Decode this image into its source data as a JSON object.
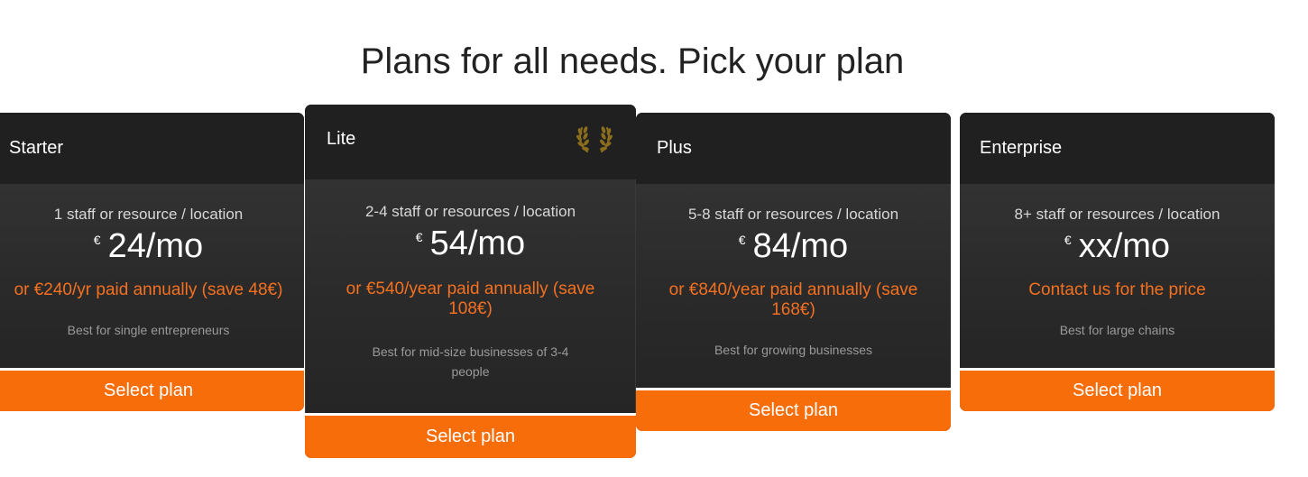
{
  "heading": "Plans for all needs. Pick your plan",
  "plans": [
    {
      "name": "Starter",
      "staff": "1 staff or resource / location",
      "currency": "€",
      "price": "24/mo",
      "annual": "or €240/yr paid annually (save 48€)",
      "best_for": "Best for single entrepreneurs",
      "button": "Select plan"
    },
    {
      "name": "Lite",
      "staff": "2-4 staff or resources / location",
      "currency": "€",
      "price": "54/mo",
      "annual": "or €540/year paid annually (save 108€)",
      "best_for": "Best for mid-size businesses of 3-4 people",
      "button": "Select plan",
      "badge_icon": "laurel-wreath-icon"
    },
    {
      "name": "Plus",
      "staff": "5-8 staff or resources / location",
      "currency": "€",
      "price": "84/mo",
      "annual": "or €840/year paid annually (save 168€)",
      "best_for": "Best for growing businesses",
      "button": "Select plan"
    },
    {
      "name": "Enterprise",
      "staff": "8+ staff or resources / location",
      "currency": "€",
      "price": "xx/mo",
      "annual": "Contact us for the price",
      "best_for": "Best for large chains",
      "button": "Select plan"
    }
  ],
  "colors": {
    "accent": "#f66d0a",
    "accent_text": "#f37021",
    "card_header": "#202020",
    "card_body": "#2c2c2c",
    "laurel": "#8a6d1d"
  }
}
